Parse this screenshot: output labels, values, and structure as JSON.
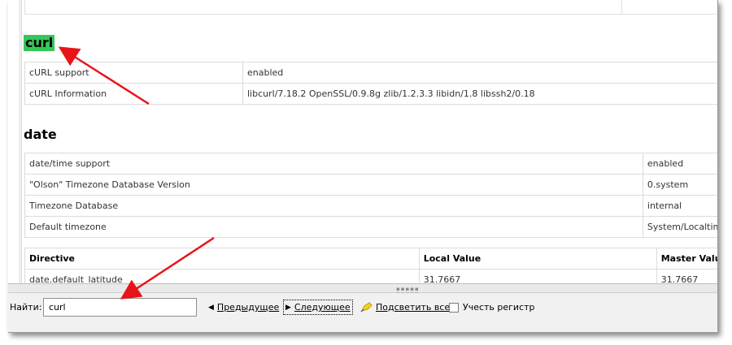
{
  "page": {
    "sections": {
      "curl": {
        "title": "curl",
        "rows": [
          {
            "label": "cURL support",
            "value": "enabled"
          },
          {
            "label": "cURL Information",
            "value": "libcurl/7.18.2 OpenSSL/0.9.8g zlib/1.2.3.3 libidn/1.8 libssh2/0.18"
          }
        ]
      },
      "date": {
        "title": "date",
        "rows": [
          {
            "label": "date/time support",
            "value": "enabled"
          },
          {
            "label": "\"Olson\" Timezone Database Version",
            "value": "0.system"
          },
          {
            "label": "Timezone Database",
            "value": "internal"
          },
          {
            "label": "Default timezone",
            "value": "System/Localtime"
          }
        ]
      },
      "directives": {
        "headers": [
          "Directive",
          "Local Value",
          "Master Value"
        ],
        "rows": [
          {
            "directive": "date.default_latitude",
            "local": "31.7667",
            "master": "31.7667"
          }
        ]
      }
    }
  },
  "findbar": {
    "label": "Найти:",
    "input_value": "curl",
    "prev_label": "Предыдущее",
    "next_label": "Следующее",
    "highlight_label": "Подсветить все",
    "match_case_label": "Учесть регистр",
    "match_case_checked": false
  },
  "colors": {
    "highlight": "#35c75a",
    "annotation_arrow": "#e8141a"
  }
}
